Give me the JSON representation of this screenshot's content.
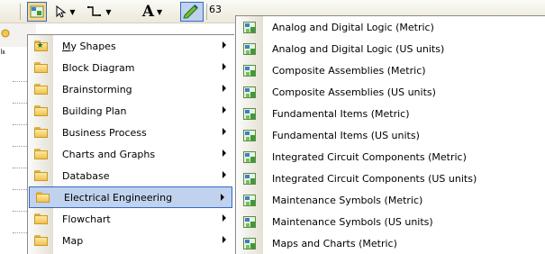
{
  "toolbar": {
    "zoom_text": "63",
    "font_color_glyph": "A"
  },
  "menu": {
    "items": [
      {
        "label": "My Shapes",
        "mnemonic": "M",
        "rest": "y Shapes",
        "icon": "star-folder-icon",
        "has_submenu": true,
        "highlighted": false
      },
      {
        "label": "Block Diagram",
        "icon": "folder-icon",
        "has_submenu": true,
        "highlighted": false
      },
      {
        "label": "Brainstorming",
        "icon": "folder-icon",
        "has_submenu": true,
        "highlighted": false
      },
      {
        "label": "Building Plan",
        "icon": "folder-icon",
        "has_submenu": true,
        "highlighted": false
      },
      {
        "label": "Business Process",
        "icon": "folder-icon",
        "has_submenu": true,
        "highlighted": false
      },
      {
        "label": "Charts and Graphs",
        "icon": "folder-icon",
        "has_submenu": true,
        "highlighted": false
      },
      {
        "label": "Database",
        "icon": "folder-icon",
        "has_submenu": true,
        "highlighted": false
      },
      {
        "label": "Electrical Engineering",
        "icon": "folder-icon",
        "has_submenu": true,
        "highlighted": true
      },
      {
        "label": "Flowchart",
        "icon": "folder-icon",
        "has_submenu": true,
        "highlighted": false
      },
      {
        "label": "Map",
        "icon": "folder-icon",
        "has_submenu": true,
        "highlighted": false
      }
    ]
  },
  "submenu": {
    "items": [
      {
        "label": "Analog and Digital Logic (Metric)"
      },
      {
        "label": "Analog and Digital Logic (US units)"
      },
      {
        "label": "Composite Assemblies (Metric)"
      },
      {
        "label": "Composite Assemblies (US units)"
      },
      {
        "label": "Fundamental Items (Metric)"
      },
      {
        "label": "Fundamental Items (US units)"
      },
      {
        "label": "Integrated Circuit Components (Metric)"
      },
      {
        "label": "Integrated Circuit Components (US units)"
      },
      {
        "label": "Maintenance Symbols (Metric)"
      },
      {
        "label": "Maintenance Symbols (US units)"
      },
      {
        "label": "Maps and Charts (Metric)"
      }
    ]
  },
  "colors": {
    "highlight_fill": "#c1d2ee",
    "highlight_border": "#316ac5",
    "folder_yellow": "#f1c24c"
  }
}
